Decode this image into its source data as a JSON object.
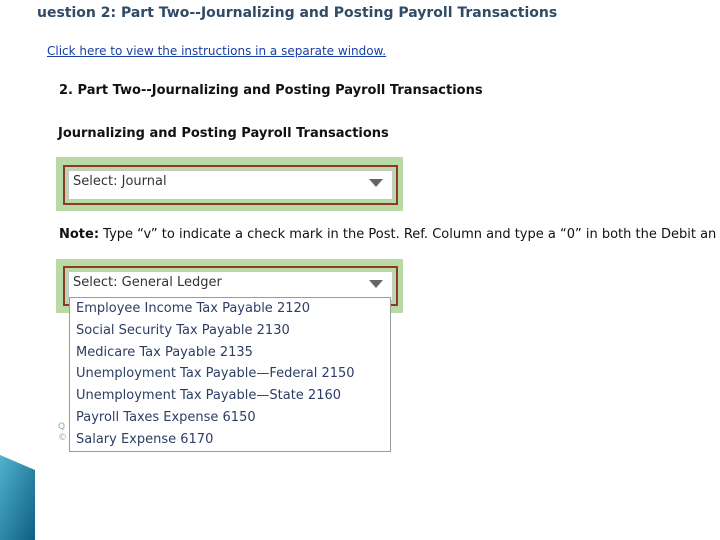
{
  "header": {
    "title": "uestion 2: Part Two--Journalizing and Posting Payroll Transactions",
    "instructions_link": "Click here to view the instructions in a separate window."
  },
  "section": {
    "heading": "2. Part Two--Journalizing and Posting Payroll Transactions",
    "subheading": "Journalizing and Posting Payroll Transactions"
  },
  "journal_select": {
    "selected": "Select: Journal"
  },
  "note": {
    "label": "Note:",
    "text": " Type “v” to indicate a check mark in the Post. Ref. Column and type a “0” in both the Debit an"
  },
  "ledger_select": {
    "selected": "Select: General Ledger",
    "options": [
      "Employee Income Tax Payable 2120",
      "Social Security Tax Payable 2130",
      "Medicare Tax Payable 2135",
      "Unemployment Tax Payable—Federal 2150",
      "Unemployment Tax Payable—State 2160",
      "Payroll Taxes Expense 6150",
      "Salary Expense 6170"
    ]
  },
  "obscured": {
    "line1": "Q",
    "line2": "©"
  },
  "colors": {
    "panel_green": "#b9d9a5",
    "select_border": "#8b3a2a",
    "link_blue": "#1a3fa6",
    "deco_teal": "#1f7fa0"
  }
}
